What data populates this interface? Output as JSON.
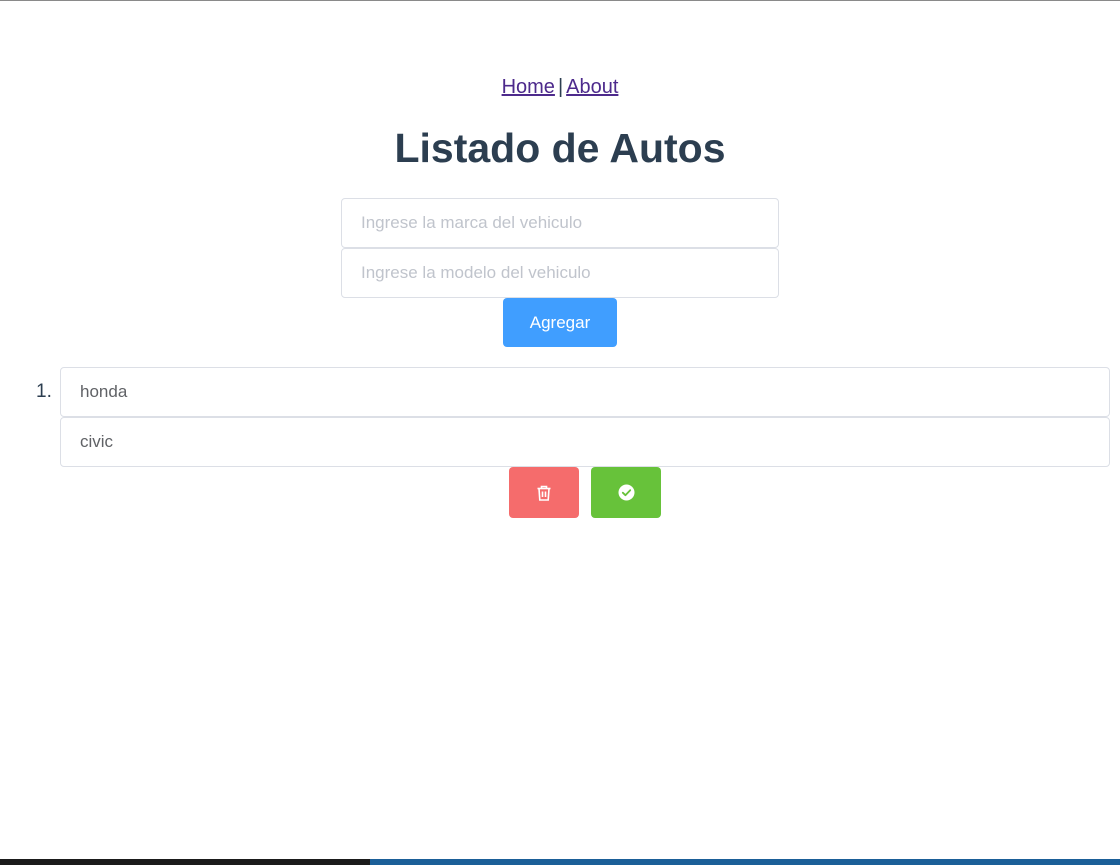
{
  "nav": {
    "home_label": "Home",
    "separator": "|",
    "about_label": "About"
  },
  "page": {
    "title": "Listado de Autos"
  },
  "form": {
    "marca_placeholder": "Ingrese la marca del vehiculo",
    "modelo_placeholder": "Ingrese la modelo del vehiculo",
    "add_button_label": "Agregar"
  },
  "cars": [
    {
      "number": "1.",
      "marca": "honda",
      "modelo": "civic"
    }
  ],
  "colors": {
    "primary": "#409eff",
    "danger": "#f56c6c",
    "success": "#67c23a",
    "text": "#2c3e50",
    "link": "#4d2a8c"
  },
  "icons": {
    "delete": "trash-icon",
    "confirm": "check-circle-icon"
  }
}
